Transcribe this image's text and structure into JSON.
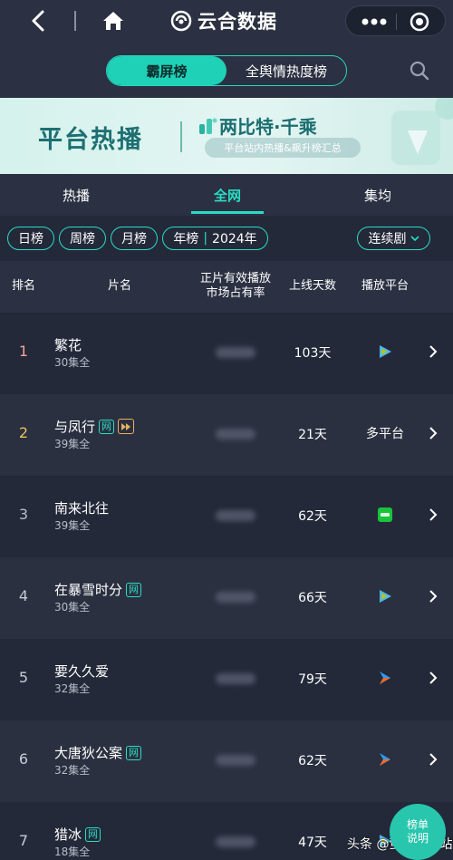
{
  "brand": {
    "name": "云合数据"
  },
  "segment": {
    "active": "霸屏榜",
    "other": "全舆情热度榜"
  },
  "banner": {
    "title": "平台热播",
    "brand": "两比特·千乘",
    "subtitle": "平台站内热播&飙升榜汇总"
  },
  "tabs": [
    "热播",
    "全网",
    "集均"
  ],
  "filters": {
    "day": "日榜",
    "week": "周榜",
    "month": "月榜",
    "year": "年榜",
    "year_value": "2024年",
    "type": "连续剧"
  },
  "columns": {
    "rank": "排名",
    "title": "片名",
    "share_line1": "正片有效播放",
    "share_line2": "市场占有率",
    "days": "上线天数",
    "platform": "播放平台"
  },
  "colors": {
    "accent": "#2adcc4",
    "rank1": "#f0a59a",
    "rank2": "#e8c45a",
    "rank3": "#b8bcc8",
    "rank_other": "#c9ccd6"
  },
  "rows": [
    {
      "rank": "1",
      "title": "繁花",
      "eps": "30集全",
      "days": "103天",
      "platform_icon": "tencent-video-icon",
      "tags": []
    },
    {
      "rank": "2",
      "title": "与凤行",
      "eps": "39集全",
      "days": "21天",
      "platform_text": "多平台",
      "tags": [
        "网",
        "play"
      ]
    },
    {
      "rank": "3",
      "title": "南来北往",
      "eps": "39集全",
      "days": "62天",
      "platform_icon": "iqiyi-icon",
      "tags": []
    },
    {
      "rank": "4",
      "title": "在暴雪时分",
      "eps": "30集全",
      "days": "66天",
      "platform_icon": "tencent-video-icon",
      "tags": [
        "网"
      ]
    },
    {
      "rank": "5",
      "title": "要久久爱",
      "eps": "32集全",
      "days": "79天",
      "platform_icon": "youku-icon",
      "tags": []
    },
    {
      "rank": "6",
      "title": "大唐狄公案",
      "eps": "32集全",
      "days": "62天",
      "platform_icon": "youku-icon",
      "tags": [
        "网"
      ]
    },
    {
      "rank": "7",
      "title": "猎冰",
      "eps": "18集全",
      "days": "47天",
      "platform_icon": "tencent-video-icon",
      "tags": [
        "网"
      ]
    }
  ],
  "fab": {
    "line1": "榜单",
    "line2": "说明"
  },
  "watermark": "头条 @萤火虫小站"
}
